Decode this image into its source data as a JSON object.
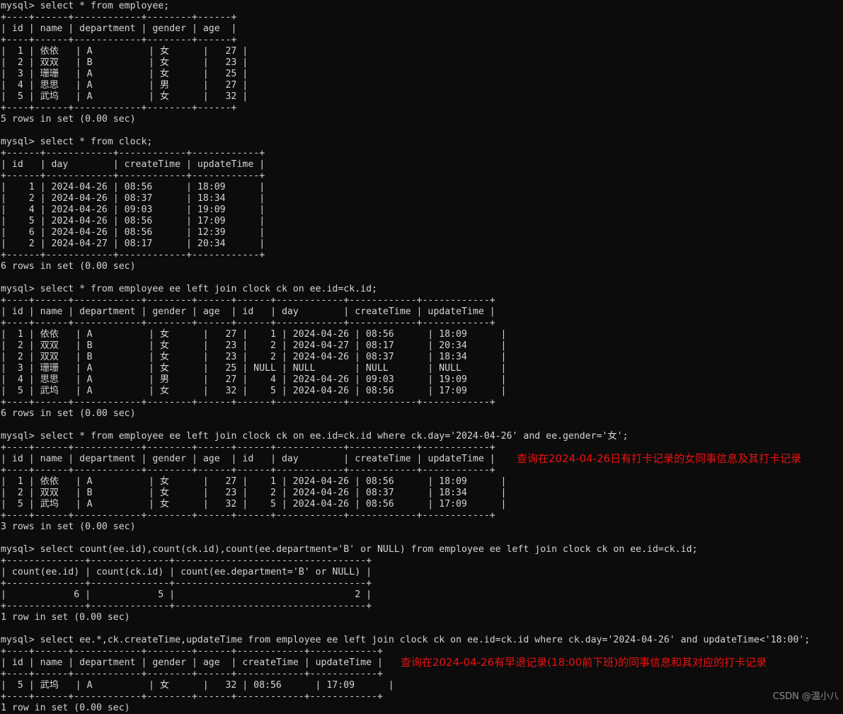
{
  "terminal": {
    "prompt": "mysql> ",
    "background_color": "#0c0c0c",
    "text_color": "#d4d4d4",
    "lines": [
      "mysql> select * from employee;",
      "+----+------+------------+--------+------+",
      "| id | name | department | gender | age  |",
      "+----+------+------------+--------+------+",
      "|  1 | 依依   | A          | 女      |   27 |",
      "|  2 | 双双   | B          | 女      |   23 |",
      "|  3 | 珊珊   | A          | 女      |   25 |",
      "|  4 | 思思   | A          | 男      |   27 |",
      "|  5 | 武坞   | A          | 女      |   32 |",
      "+----+------+------------+--------+------+",
      "5 rows in set (0.00 sec)",
      "",
      "mysql> select * from clock;",
      "+------+------------+------------+------------+",
      "| id   | day        | createTime | updateTime |",
      "+------+------------+------------+------------+",
      "|    1 | 2024-04-26 | 08:56      | 18:09      |",
      "|    2 | 2024-04-26 | 08:37      | 18:34      |",
      "|    4 | 2024-04-26 | 09:03      | 19:09      |",
      "|    5 | 2024-04-26 | 08:56      | 17:09      |",
      "|    6 | 2024-04-26 | 08:56      | 12:39      |",
      "|    2 | 2024-04-27 | 08:17      | 20:34      |",
      "+------+------------+------------+------------+",
      "6 rows in set (0.00 sec)",
      "",
      "mysql> select * from employee ee left join clock ck on ee.id=ck.id;",
      "+----+------+------------+--------+------+------+------------+------------+------------+",
      "| id | name | department | gender | age  | id   | day        | createTime | updateTime |",
      "+----+------+------------+--------+------+------+------------+------------+------------+",
      "|  1 | 依依   | A          | 女      |   27 |    1 | 2024-04-26 | 08:56      | 18:09      |",
      "|  2 | 双双   | B          | 女      |   23 |    2 | 2024-04-27 | 08:17      | 20:34      |",
      "|  2 | 双双   | B          | 女      |   23 |    2 | 2024-04-26 | 08:37      | 18:34      |",
      "|  3 | 珊珊   | A          | 女      |   25 | NULL | NULL       | NULL       | NULL       |",
      "|  4 | 思思   | A          | 男      |   27 |    4 | 2024-04-26 | 09:03      | 19:09      |",
      "|  5 | 武坞   | A          | 女      |   32 |    5 | 2024-04-26 | 08:56      | 17:09      |",
      "+----+------+------------+--------+------+------+------------+------------+------------+",
      "6 rows in set (0.00 sec)",
      "",
      "mysql> select * from employee ee left join clock ck on ee.id=ck.id where ck.day='2024-04-26' and ee.gender='女';",
      "+----+------+------------+--------+------+------+------------+------------+------------+",
      "| id | name | department | gender | age  | id   | day        | createTime | updateTime |",
      "+----+------+------------+--------+------+------+------------+------------+------------+",
      "|  1 | 依依   | A          | 女      |   27 |    1 | 2024-04-26 | 08:56      | 18:09      |",
      "|  2 | 双双   | B          | 女      |   23 |    2 | 2024-04-26 | 08:37      | 18:34      |",
      "|  5 | 武坞   | A          | 女      |   32 |    5 | 2024-04-26 | 08:56      | 17:09      |",
      "+----+------+------------+--------+------+------+------------+------------+------------+",
      "3 rows in set (0.00 sec)",
      "",
      "mysql> select count(ee.id),count(ck.id),count(ee.department='B' or NULL) from employee ee left join clock ck on ee.id=ck.id;",
      "+--------------+--------------+----------------------------------+",
      "| count(ee.id) | count(ck.id) | count(ee.department='B' or NULL) |",
      "+--------------+--------------+----------------------------------+",
      "|            6 |            5 |                                2 |",
      "+--------------+--------------+----------------------------------+",
      "1 row in set (0.00 sec)",
      "",
      "mysql> select ee.*,ck.createTime,updateTime from employee ee left join clock ck on ee.id=ck.id where ck.day='2024-04-26' and updateTime<'18:00';",
      "+----+------+------------+--------+------+------------+------------+",
      "| id | name | department | gender | age  | createTime | updateTime |",
      "+----+------+------------+--------+------+------------+------------+",
      "|  5 | 武坞   | A          | 女      |   32 | 08:56      | 17:09      |",
      "+----+------+------------+--------+------+------------+------------+",
      "1 row in set (0.00 sec)"
    ]
  },
  "annotations": {
    "color": "#ef1111",
    "items": [
      "查询在2024-04-26日有打卡记录的女同事信息及其打卡记录",
      "查询在2024-04-26有早退记录(18:00前下班)的同事信息和其对应的打卡记录"
    ]
  },
  "watermark": {
    "text": "CSDN @温小八"
  },
  "queries": [
    {
      "sql": "select * from employee;",
      "result_table": {
        "columns": [
          "id",
          "name",
          "department",
          "gender",
          "age"
        ],
        "rows": [
          [
            "1",
            "依依",
            "A",
            "女",
            "27"
          ],
          [
            "2",
            "双双",
            "B",
            "女",
            "23"
          ],
          [
            "3",
            "珊珊",
            "A",
            "女",
            "25"
          ],
          [
            "4",
            "思思",
            "A",
            "男",
            "27"
          ],
          [
            "5",
            "武坞",
            "A",
            "女",
            "32"
          ]
        ]
      },
      "status": "5 rows in set (0.00 sec)"
    },
    {
      "sql": "select * from clock;",
      "result_table": {
        "columns": [
          "id",
          "day",
          "createTime",
          "updateTime"
        ],
        "rows": [
          [
            "1",
            "2024-04-26",
            "08:56",
            "18:09"
          ],
          [
            "2",
            "2024-04-26",
            "08:37",
            "18:34"
          ],
          [
            "4",
            "2024-04-26",
            "09:03",
            "19:09"
          ],
          [
            "5",
            "2024-04-26",
            "08:56",
            "17:09"
          ],
          [
            "6",
            "2024-04-26",
            "08:56",
            "12:39"
          ],
          [
            "2",
            "2024-04-27",
            "08:17",
            "20:34"
          ]
        ]
      },
      "status": "6 rows in set (0.00 sec)"
    },
    {
      "sql": "select * from employee ee left join clock ck on ee.id=ck.id;",
      "result_table": {
        "columns": [
          "id",
          "name",
          "department",
          "gender",
          "age",
          "id",
          "day",
          "createTime",
          "updateTime"
        ],
        "rows": [
          [
            "1",
            "依依",
            "A",
            "女",
            "27",
            "1",
            "2024-04-26",
            "08:56",
            "18:09"
          ],
          [
            "2",
            "双双",
            "B",
            "女",
            "23",
            "2",
            "2024-04-27",
            "08:17",
            "20:34"
          ],
          [
            "2",
            "双双",
            "B",
            "女",
            "23",
            "2",
            "2024-04-26",
            "08:37",
            "18:34"
          ],
          [
            "3",
            "珊珊",
            "A",
            "女",
            "25",
            "NULL",
            "NULL",
            "NULL",
            "NULL"
          ],
          [
            "4",
            "思思",
            "A",
            "男",
            "27",
            "4",
            "2024-04-26",
            "09:03",
            "19:09"
          ],
          [
            "5",
            "武坞",
            "A",
            "女",
            "32",
            "5",
            "2024-04-26",
            "08:56",
            "17:09"
          ]
        ]
      },
      "status": "6 rows in set (0.00 sec)"
    },
    {
      "sql": "select * from employee ee left join clock ck on ee.id=ck.id where ck.day='2024-04-26' and ee.gender='女';",
      "annotation": "查询在2024-04-26日有打卡记录的女同事信息及其打卡记录",
      "result_table": {
        "columns": [
          "id",
          "name",
          "department",
          "gender",
          "age",
          "id",
          "day",
          "createTime",
          "updateTime"
        ],
        "rows": [
          [
            "1",
            "依依",
            "A",
            "女",
            "27",
            "1",
            "2024-04-26",
            "08:56",
            "18:09"
          ],
          [
            "2",
            "双双",
            "B",
            "女",
            "23",
            "2",
            "2024-04-26",
            "08:37",
            "18:34"
          ],
          [
            "5",
            "武坞",
            "A",
            "女",
            "32",
            "5",
            "2024-04-26",
            "08:56",
            "17:09"
          ]
        ]
      },
      "status": "3 rows in set (0.00 sec)"
    },
    {
      "sql": "select count(ee.id),count(ck.id),count(ee.department='B' or NULL) from employee ee left join clock ck on ee.id=ck.id;",
      "result_table": {
        "columns": [
          "count(ee.id)",
          "count(ck.id)",
          "count(ee.department='B' or NULL)"
        ],
        "rows": [
          [
            "6",
            "5",
            "2"
          ]
        ]
      },
      "status": "1 row in set (0.00 sec)"
    },
    {
      "sql": "select ee.*,ck.createTime,updateTime from employee ee left join clock ck on ee.id=ck.id where ck.day='2024-04-26' and updateTime<'18:00';",
      "annotation": "查询在2024-04-26有早退记录(18:00前下班)的同事信息和其对应的打卡记录",
      "result_table": {
        "columns": [
          "id",
          "name",
          "department",
          "gender",
          "age",
          "createTime",
          "updateTime"
        ],
        "rows": [
          [
            "5",
            "武坞",
            "A",
            "女",
            "32",
            "08:56",
            "17:09"
          ]
        ]
      },
      "status": "1 row in set (0.00 sec)"
    }
  ]
}
